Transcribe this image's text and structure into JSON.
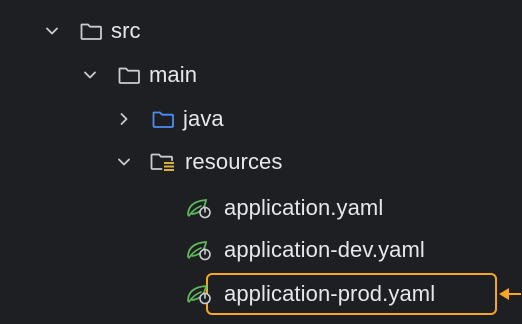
{
  "colors": {
    "background": "#1e1f22",
    "text": "#e6e7eb",
    "folder_gray": "#c9ccd2",
    "folder_blue": "#4a8ef5",
    "resource_yellow": "#d8b13a",
    "spring_green": "#5fb85a",
    "highlight": "#f5a623"
  },
  "tree": {
    "src": {
      "label": "src",
      "icon": "folder-icon",
      "expanded": true
    },
    "main": {
      "label": "main",
      "icon": "folder-icon",
      "expanded": true
    },
    "java": {
      "label": "java",
      "icon": "source-folder-icon",
      "expanded": false
    },
    "resources": {
      "label": "resources",
      "icon": "resources-folder-icon",
      "expanded": true
    },
    "files": [
      {
        "label": "application.yaml",
        "icon": "spring-config-icon"
      },
      {
        "label": "application-dev.yaml",
        "icon": "spring-config-icon"
      },
      {
        "label": "application-prod.yaml",
        "icon": "spring-config-icon",
        "highlighted": true
      }
    ]
  }
}
